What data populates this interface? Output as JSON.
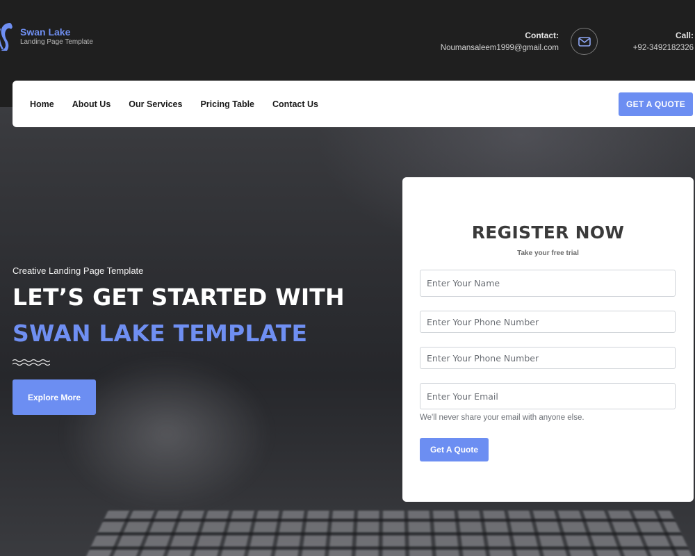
{
  "brand": {
    "name": "Swan Lake",
    "tagline": "Landing Page Template",
    "logo_icon": "swan-logo-icon",
    "accent_color": "#6c8ef2"
  },
  "contact": {
    "email_label": "Contact:",
    "email_value": "Noumansaleem1999@gmail.com",
    "mail_icon": "mail-icon",
    "call_label": "Call:",
    "call_value": "+92-3492182326"
  },
  "nav": {
    "items": [
      {
        "label": "Home"
      },
      {
        "label": "About Us"
      },
      {
        "label": "Our Services"
      },
      {
        "label": "Pricing Table"
      },
      {
        "label": "Contact Us"
      }
    ],
    "cta_label": "GET A QUOTE"
  },
  "hero": {
    "subtitle": "Creative Landing Page Template",
    "headline_line1": "LET’S GET STARTED WITH",
    "headline_line2": "SWAN LAKE TEMPLATE",
    "decoration_icon": "wave-lines-icon",
    "button_label": "Explore More"
  },
  "register": {
    "title": "REGISTER NOW",
    "subtitle": "Take your free trial",
    "name_placeholder": "Enter Your Name",
    "phone_placeholder_1": "Enter Your Phone Number",
    "phone_placeholder_2": "Enter Your Phone Number",
    "email_placeholder": "Enter Your Email",
    "email_help": "We'll never share your email with anyone else.",
    "submit_label": "Get A Quote"
  }
}
